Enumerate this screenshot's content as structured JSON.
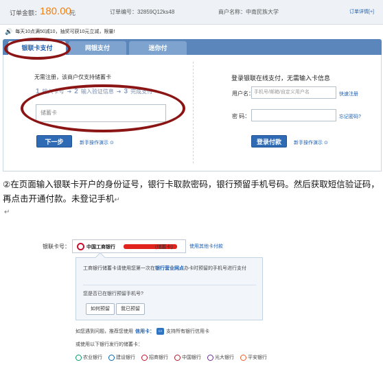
{
  "order": {
    "amount_label": "订单金额：",
    "amount": "180.00",
    "unit": "元",
    "order_no": "订单编号：32859Q12ks48",
    "merchant": "商户名称：中南民族大学",
    "detail_link": "订单详情[+]"
  },
  "notice": "每天10点满50减10，抽奖可获10元立减，限量!",
  "tabs": [
    {
      "label": "银联卡支付"
    },
    {
      "label": "网银支付"
    },
    {
      "label": "迷你付"
    }
  ],
  "left": {
    "title": "无需注册，该商户仅支持储蓄卡",
    "steps": [
      {
        "num": "1",
        "label": "输入卡号"
      },
      {
        "num": "2",
        "label": "输入验证信息"
      },
      {
        "num": "3",
        "label": "完成支付"
      }
    ],
    "card_placeholder": "储蓄卡",
    "next_button": "下一步",
    "demo_link": "新手操作演示 ⊙"
  },
  "right": {
    "title": "登录银联在线支付，无需输入卡信息",
    "username_label": "用户名：",
    "username_placeholder": "手机号/邮箱/自定义用户名",
    "register_link": "快速注册",
    "password_label": "密  码：",
    "forgot_link": "忘记密码?",
    "login_button": "登录付款",
    "demo_link": "新手操作演示 ⊙"
  },
  "instruction": "②在页面输入银联卡开户的身份证号，银行卡取款密码，银行预留手机号码。然后获取短信验证码，再点击开通付款。未登记手机",
  "return_mark": "↵",
  "lower": {
    "card_label": "银联卡号：",
    "bank_name": "中国工商银行",
    "card_type": "(储蓄卡)",
    "other_card_link": "使用其他卡付款",
    "message_pre": "工商银行储蓄卡请使用您第一次在",
    "message_link": "银行营业网点",
    "message_post": "办卡时预留的手机号进行支付",
    "question": "您是否已在银行预留手机号?",
    "btn_how": "如何预留",
    "btn_done": "我已预留",
    "help_text": "如您遇到问题，推荐您使用",
    "help_bold": "信用卡：",
    "help_tail": "支持所有银行信用卡",
    "or_text": "或使用以下银行发行的储蓄卡：",
    "banks": [
      "农业银行",
      "建设银行",
      "招商银行",
      "中国银行",
      "光大银行",
      "平安银行"
    ]
  }
}
